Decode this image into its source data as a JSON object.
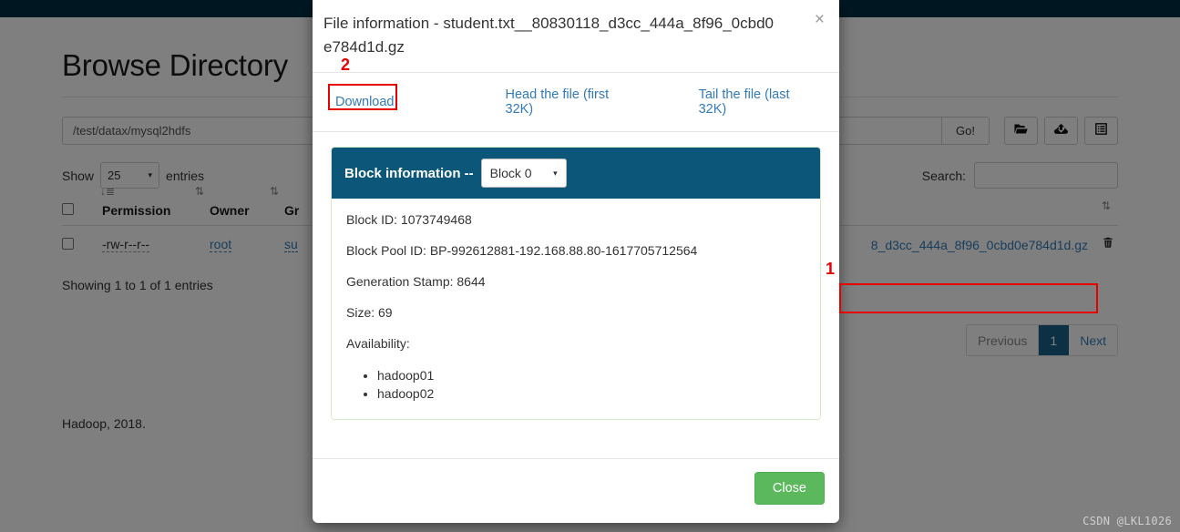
{
  "page": {
    "title": "Browse Directory",
    "path_value": "/test/datax/mysql2hdfs",
    "go_label": "Go!",
    "show_label": "Show",
    "entries_value": "25",
    "entries_label": "entries",
    "search_label": "Search:",
    "search_value": "",
    "showing_text": "Showing 1 to 1 of 1 entries",
    "footer": "Hadoop, 2018."
  },
  "toolbar": {
    "browse_icon": "folder-open-icon",
    "upload_icon": "upload-icon",
    "list_icon": "list-icon"
  },
  "table": {
    "headers": [
      "Permission",
      "Owner",
      "Gr"
    ],
    "sort_icons": [
      "sort-desc-icon",
      "sort-icon",
      "sort-icon",
      "sort-icon"
    ],
    "row": {
      "permission": "-rw-r--r--",
      "owner": "root",
      "group": "su",
      "filename": "8_d3cc_444a_8f96_0cbd0e784d1d.gz",
      "delete_icon": "trash-icon"
    }
  },
  "pagination": {
    "previous": "Previous",
    "current": "1",
    "next": "Next"
  },
  "modal": {
    "title": "File information - student.txt__80830118_d3cc_444a_8f96_0cbd0e784d1d.gz",
    "close_icon": "×",
    "links": {
      "download": "Download",
      "head": "Head the file (first 32K)",
      "tail": "Tail the file (last 32K)"
    },
    "panel": {
      "heading": "Block information --",
      "block_selected": "Block 0",
      "block_id": "Block ID: 1073749468",
      "block_pool_id": "Block Pool ID: BP-992612881-192.168.88.80-1617705712564",
      "generation_stamp": "Generation Stamp: 8644",
      "size": "Size: 69",
      "availability_label": "Availability:",
      "availability": [
        "hadoop01",
        "hadoop02"
      ]
    },
    "close_button": "Close"
  },
  "annotations": {
    "marker_one": "1",
    "marker_two": "2",
    "color": "#e60000"
  },
  "watermark": "CSDN @LKL1026"
}
